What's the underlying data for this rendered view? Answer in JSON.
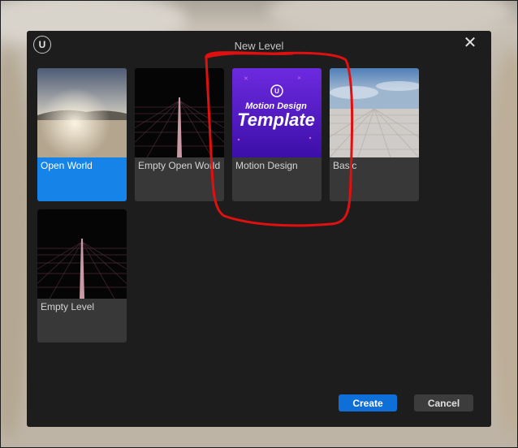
{
  "dialog": {
    "title": "New Level",
    "logo_text": "U",
    "close_glyph": "✕"
  },
  "templates": [
    {
      "label": "Open World",
      "selected": true,
      "thumb": "desert-sky"
    },
    {
      "label": "Empty Open World",
      "selected": false,
      "thumb": "neon-grid"
    },
    {
      "label": "Motion Design",
      "selected": false,
      "thumb": "purple-template",
      "thumb_text_top": "Motion Design",
      "thumb_text_main": "Template"
    },
    {
      "label": "Basic",
      "selected": false,
      "thumb": "checker-floor"
    },
    {
      "label": "Empty Level",
      "selected": false,
      "thumb": "neon-grid"
    }
  ],
  "buttons": {
    "create": "Create",
    "cancel": "Cancel"
  },
  "colors": {
    "selected": "#1583e8",
    "create": "#0f6fd8",
    "annotation": "#e01010",
    "motion_purple": "#5a1fc9"
  }
}
